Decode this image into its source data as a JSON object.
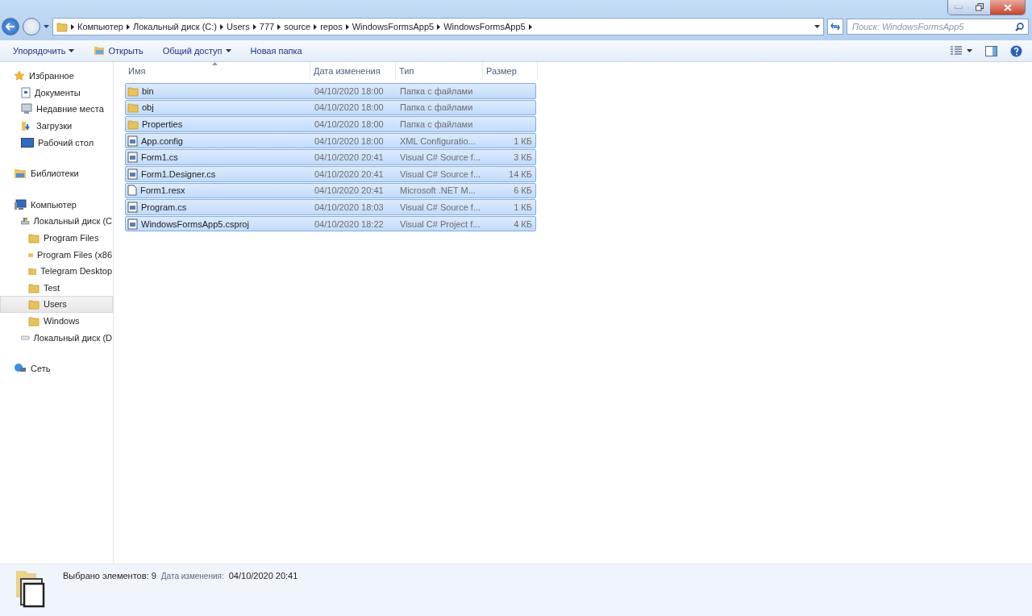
{
  "address": {
    "crumbs": [
      "Компьютер",
      "Локальный диск (C:)",
      "Users",
      "777",
      "source",
      "repos",
      "WindowsFormsApp5",
      "WindowsFormsApp5"
    ]
  },
  "search": {
    "placeholder": "Поиск: WindowsFormsApp5"
  },
  "toolbar": {
    "items": [
      {
        "label": "Упорядочить",
        "dropdown": true,
        "kind": "plain"
      },
      {
        "label": "Открыть",
        "dropdown": false,
        "kind": "open"
      },
      {
        "label": "Общий доступ",
        "dropdown": true,
        "kind": "plain"
      },
      {
        "label": "Новая папка",
        "dropdown": false,
        "kind": "plain"
      }
    ]
  },
  "sidebar": {
    "groups": [
      {
        "label": "Избранное",
        "kind": "star",
        "selected": false,
        "children": [
          {
            "label": "Документы",
            "kind": "doc",
            "selected": false
          },
          {
            "label": "Недавние места",
            "kind": "recent",
            "selected": false
          },
          {
            "label": "Загрузки",
            "kind": "download",
            "selected": false
          },
          {
            "label": "Рабочий стол",
            "kind": "desktop",
            "selected": false
          }
        ]
      },
      {
        "label": "Библиотеки",
        "kind": "library",
        "selected": false
      },
      {
        "label": "Компьютер",
        "kind": "computer",
        "selected": false,
        "children": [
          {
            "label": "Локальный диск (C",
            "kind": "drive",
            "selected": false,
            "children": [
              {
                "label": "Program Files",
                "kind": "folder",
                "selected": false
              },
              {
                "label": "Program Files (x86",
                "kind": "folder",
                "selected": false
              },
              {
                "label": "Telegram Desktop",
                "kind": "folder",
                "selected": false
              },
              {
                "label": "Test",
                "kind": "folder",
                "selected": false
              },
              {
                "label": "Users",
                "kind": "folder",
                "selected": true
              },
              {
                "label": "Windows",
                "kind": "folder",
                "selected": false
              }
            ]
          },
          {
            "label": "Локальный диск (D",
            "kind": "hdd",
            "selected": false
          }
        ]
      },
      {
        "label": "Сеть",
        "kind": "network",
        "selected": false
      }
    ]
  },
  "table": {
    "columns": [
      "Имя",
      "Дата изменения",
      "Тип",
      "Размер"
    ],
    "rows": [
      {
        "name": "bin",
        "date": "04/10/2020 18:00",
        "type": "Папка с файлами",
        "kind": "folder",
        "selected": true
      },
      {
        "name": "obj",
        "date": "04/10/2020 18:00",
        "type": "Папка с файлами",
        "kind": "folder",
        "selected": true
      },
      {
        "name": "Properties",
        "date": "04/10/2020 18:00",
        "type": "Папка с файлами",
        "kind": "folder",
        "selected": true
      },
      {
        "name": "App.config",
        "date": "04/10/2020 18:00",
        "type": "XML Configuratio...",
        "size": "1 КБ",
        "kind": "code",
        "selected": true
      },
      {
        "name": "Form1.cs",
        "date": "04/10/2020 20:41",
        "type": "Visual C# Source f...",
        "size": "3 КБ",
        "kind": "code",
        "selected": true
      },
      {
        "name": "Form1.Designer.cs",
        "date": "04/10/2020 20:41",
        "type": "Visual C# Source f...",
        "size": "14 КБ",
        "kind": "code",
        "selected": true
      },
      {
        "name": "Form1.resx",
        "date": "04/10/2020 20:41",
        "type": "Microsoft .NET M...",
        "size": "6 КБ",
        "kind": "file",
        "selected": true
      },
      {
        "name": "Program.cs",
        "date": "04/10/2020 18:03",
        "type": "Visual C# Source f...",
        "size": "1 КБ",
        "kind": "code",
        "selected": true
      },
      {
        "name": "WindowsFormsApp5.csproj",
        "date": "04/10/2020 18:22",
        "type": "Visual C# Project f...",
        "size": "4 КБ",
        "kind": "code",
        "selected": true
      }
    ]
  },
  "status_bar": {
    "count": "Выбрано элементов: 9",
    "date_label": "Дата изменения:",
    "date": "04/10/2020 20:41"
  }
}
